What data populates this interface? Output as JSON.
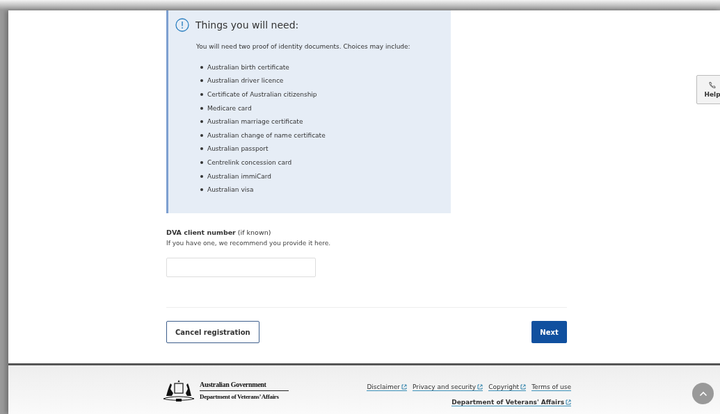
{
  "info_box": {
    "title": "Things you will need:",
    "intro": "You will need two proof of identity documents. Choices may include:",
    "items": [
      "Australian birth certificate",
      "Australian driver licence",
      "Certificate of Australian citizenship",
      "Medicare card",
      "Australian marriage certificate",
      "Australian change of name certificate",
      "Australian passport",
      "Centrelink concession card",
      "Australian immiCard",
      "Australian visa"
    ]
  },
  "field": {
    "label": "DVA client number",
    "label_note": "(if known)",
    "hint": "If you have one, we recommend you provide it here."
  },
  "buttons": {
    "cancel": "Cancel registration",
    "next": "Next"
  },
  "help": {
    "label": "Help"
  },
  "footer": {
    "logo_line_1": "Australian Government",
    "logo_line_2": "Department of Veterans’ Affairs",
    "links": [
      {
        "label": "Disclaimer",
        "external": true
      },
      {
        "label": "Privacy and security",
        "external": true
      },
      {
        "label": "Copyright",
        "external": true
      },
      {
        "label": "Terms of use",
        "external": false
      }
    ],
    "main_link": {
      "label": "Department of Veterans' Affairs",
      "external": true
    }
  }
}
